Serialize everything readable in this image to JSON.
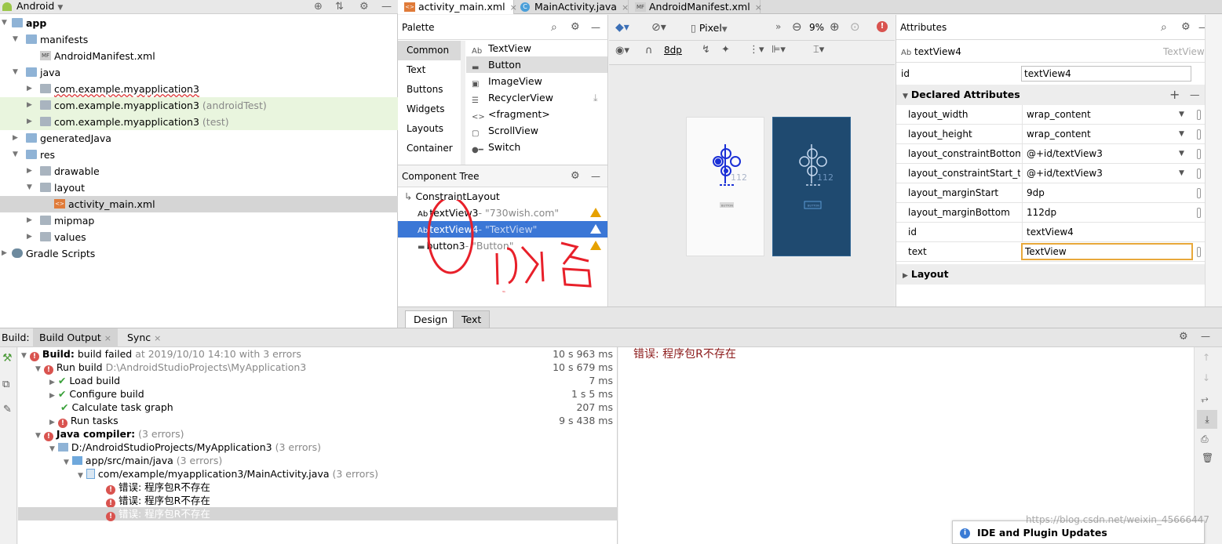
{
  "project": {
    "view_selector": "Android",
    "items": [
      {
        "label": "app",
        "suffix": ""
      },
      {
        "label": "manifests",
        "suffix": ""
      },
      {
        "label": "AndroidManifest.xml",
        "suffix": ""
      },
      {
        "label": "java",
        "suffix": ""
      },
      {
        "label": "com.example.myapplication3",
        "suffix": ""
      },
      {
        "label": "com.example.myapplication3",
        "suffix": "(androidTest)"
      },
      {
        "label": "com.example.myapplication3",
        "suffix": "(test)"
      },
      {
        "label": "generatedJava",
        "suffix": ""
      },
      {
        "label": "res",
        "suffix": ""
      },
      {
        "label": "drawable",
        "suffix": ""
      },
      {
        "label": "layout",
        "suffix": ""
      },
      {
        "label": "activity_main.xml",
        "suffix": ""
      },
      {
        "label": "mipmap",
        "suffix": ""
      },
      {
        "label": "values",
        "suffix": ""
      },
      {
        "label": "Gradle Scripts",
        "suffix": ""
      }
    ]
  },
  "editor_tabs": [
    {
      "label": "activity_main.xml",
      "icon_label": "<>"
    },
    {
      "label": "MainActivity.java",
      "icon_label": "C"
    },
    {
      "label": "AndroidManifest.xml",
      "icon_label": "MF"
    }
  ],
  "close_glyph": "×",
  "palette": {
    "title": "Palette",
    "categories": [
      "Common",
      "Text",
      "Buttons",
      "Widgets",
      "Layouts",
      "Container"
    ],
    "items": [
      {
        "icon": "Ab",
        "label": "TextView"
      },
      {
        "icon": "▬",
        "label": "Button"
      },
      {
        "icon": "▣",
        "label": "ImageView"
      },
      {
        "icon": "☰",
        "label": "RecyclerView"
      },
      {
        "icon": "<>",
        "label": "<fragment>"
      },
      {
        "icon": "▢",
        "label": "ScrollView"
      },
      {
        "icon": "●━",
        "label": "Switch"
      }
    ]
  },
  "component_tree": {
    "title": "Component Tree",
    "root": "ConstraintLayout",
    "rows": [
      {
        "icon": "Ab",
        "name": "textView3",
        "detail": "- \"730wish.com\""
      },
      {
        "icon": "Ab",
        "name": "textView4",
        "detail": "- \"TextView\""
      },
      {
        "icon": "▬",
        "name": "button3",
        "detail": "- \"Button\""
      }
    ]
  },
  "design_toolbar": {
    "device": "Pixel",
    "zoom": "9%",
    "margin": "8dp",
    "preview_margin_label": "112",
    "preview_button_label": "BUTTON"
  },
  "annotation": {
    "handwritten": "叫名"
  },
  "attributes": {
    "title": "Attributes",
    "component_icon": "Ab",
    "component_name": "textView4",
    "component_type": "TextView",
    "id_label": "id",
    "id_value": "textView4",
    "declared_title": "Declared Attributes",
    "rows": [
      {
        "key": "layout_width",
        "value": "wrap_content"
      },
      {
        "key": "layout_height",
        "value": "wrap_content"
      },
      {
        "key": "layout_constraintBottom_toBottomOf",
        "value": "@+id/textView3"
      },
      {
        "key": "layout_constraintStart_toStartOf",
        "value": "@+id/textView3"
      },
      {
        "key": "layout_marginStart",
        "value": "9dp"
      },
      {
        "key": "layout_marginBottom",
        "value": "112dp"
      },
      {
        "key": "id",
        "value": "textView4"
      },
      {
        "key": "text",
        "value": "TextView"
      }
    ],
    "layout_title": "Layout"
  },
  "design_tabs": [
    "Design",
    "Text"
  ],
  "build": {
    "label": "Build:",
    "tabs": [
      "Build Output",
      "Sync"
    ],
    "rows": [
      {
        "title": "Build:",
        "text": "build failed",
        "detail": "at 2019/10/10 14:10",
        "extra": "with 3 errors",
        "time": "10 s 963 ms"
      },
      {
        "title": "",
        "text": "Run build",
        "detail": "D:\\AndroidStudioProjects\\MyApplication3",
        "extra": "",
        "time": "10 s 679 ms"
      },
      {
        "title": "",
        "text": "Load build",
        "detail": "",
        "extra": "",
        "time": "7 ms"
      },
      {
        "title": "",
        "text": "Configure build",
        "detail": "",
        "extra": "",
        "time": "1 s 5 ms"
      },
      {
        "title": "",
        "text": "Calculate task graph",
        "detail": "",
        "extra": "",
        "time": "207 ms"
      },
      {
        "title": "",
        "text": "Run tasks",
        "detail": "",
        "extra": "",
        "time": "9 s 438 ms"
      },
      {
        "title": "Java compiler:",
        "text": "",
        "detail": "",
        "extra": "(3 errors)",
        "time": ""
      },
      {
        "title": "",
        "text": "D:/AndroidStudioProjects/MyApplication3",
        "detail": "",
        "extra": "(3 errors)",
        "time": ""
      },
      {
        "title": "",
        "text": "app/src/main/java",
        "detail": "",
        "extra": "(3 errors)",
        "time": ""
      },
      {
        "title": "",
        "text": "com/example/myapplication3/MainActivity.java",
        "detail": "",
        "extra": "(3 errors)",
        "time": ""
      },
      {
        "title": "",
        "text": "错误: 程序包R不存在",
        "detail": "",
        "extra": "",
        "time": ""
      },
      {
        "title": "",
        "text": "错误: 程序包R不存在",
        "detail": "",
        "extra": "",
        "time": ""
      },
      {
        "title": "",
        "text": "错误: 程序包R不存在",
        "detail": "",
        "extra": "",
        "time": ""
      }
    ],
    "output_text": "错误: 程序包R不存在"
  },
  "notification": {
    "title": "IDE and Plugin Updates",
    "watermark": "https://blog.csdn.net/weixin_45666447"
  },
  "colors": {
    "selection": "#3b77d6",
    "error": "#d9534f",
    "warning": "#e6a100",
    "annotation": "#e8202a",
    "blueprint": "#1f4a70"
  }
}
